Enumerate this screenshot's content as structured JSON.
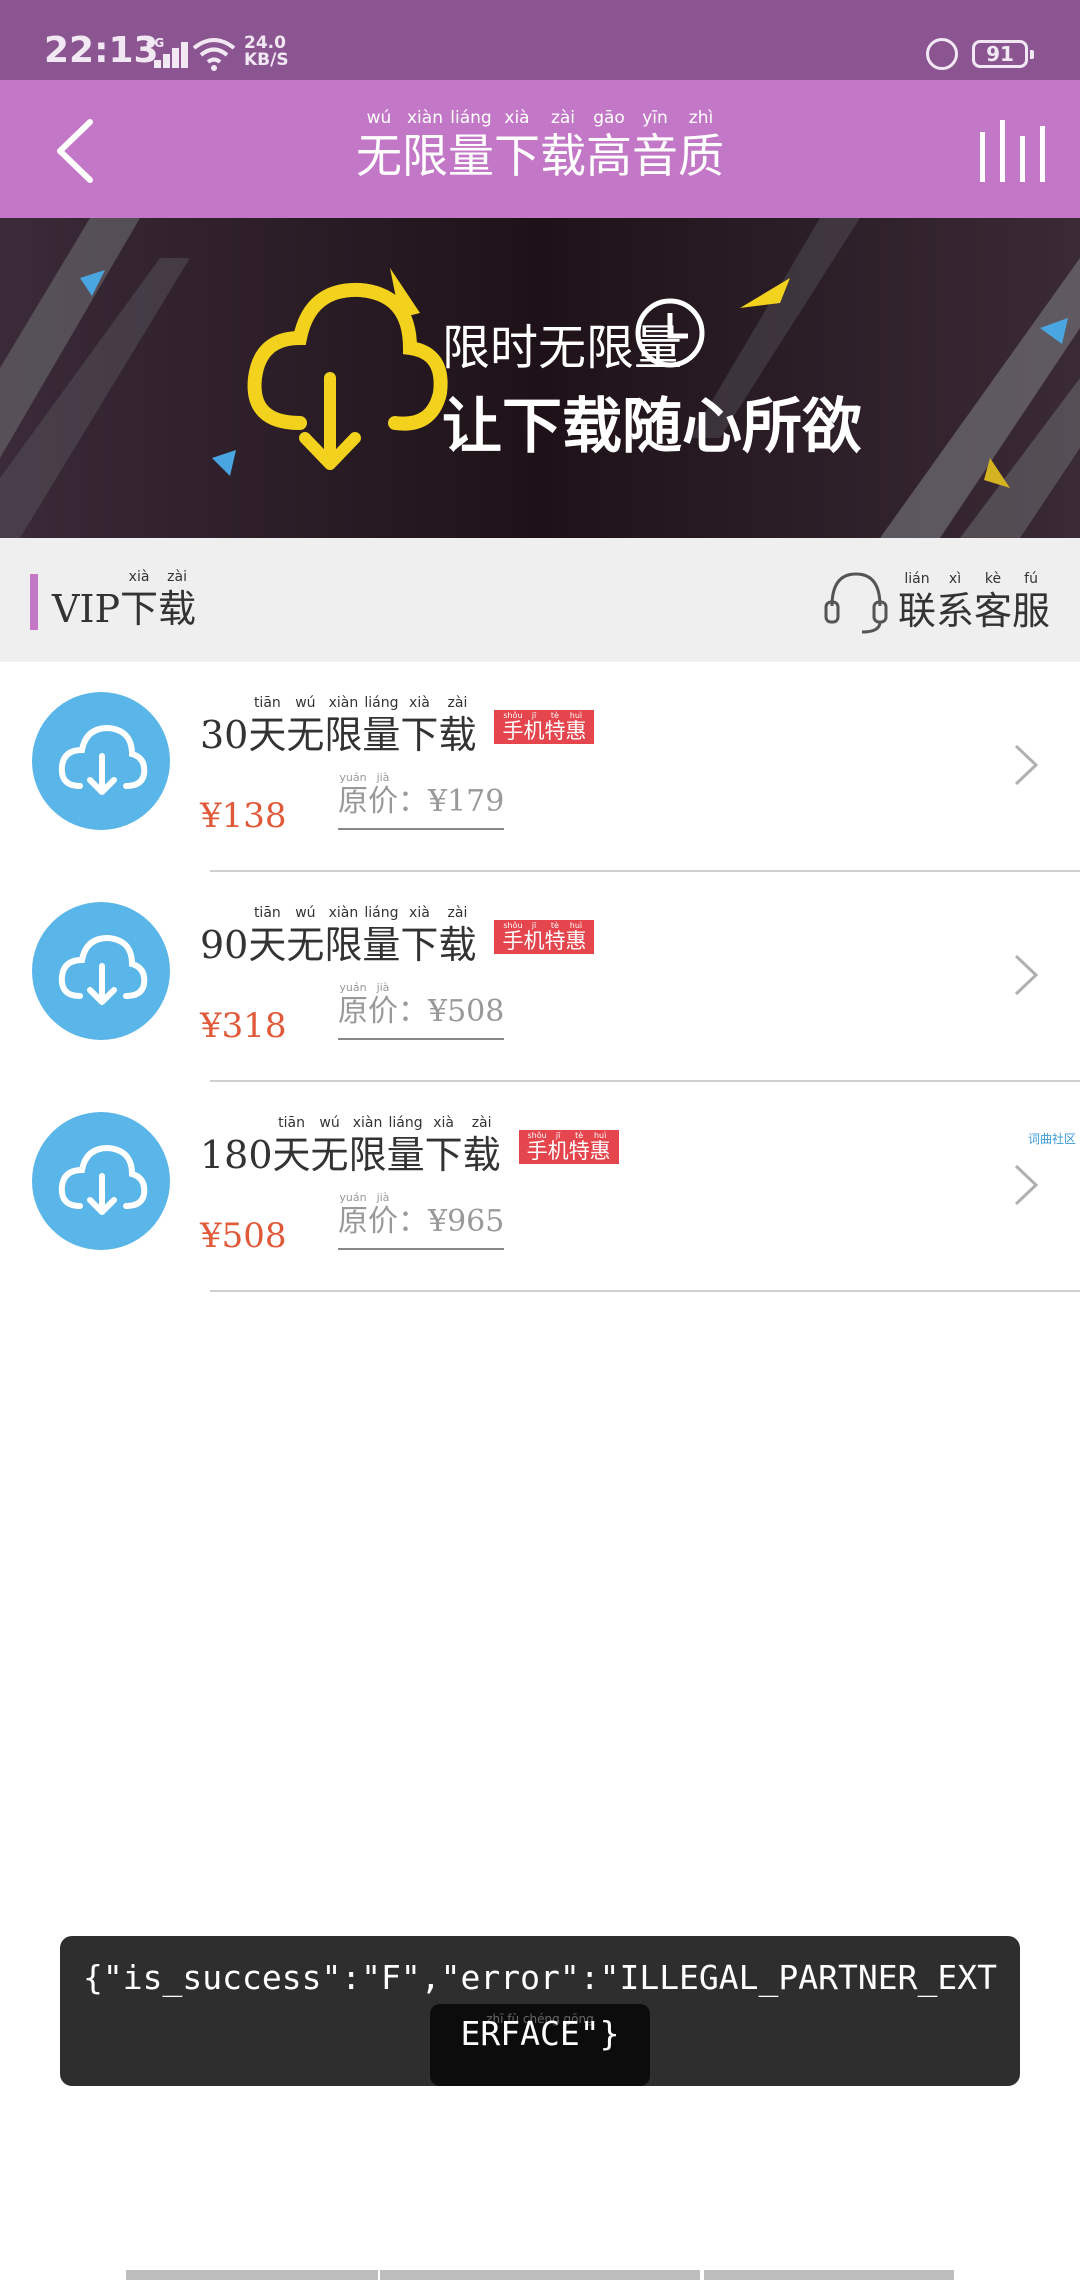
{
  "status_bar": {
    "time": "22:13",
    "network": "4G",
    "speed_value": "24.0",
    "speed_unit": "KB/S",
    "battery": "91"
  },
  "header": {
    "title": [
      {
        "py": "wú",
        "ch": "无"
      },
      {
        "py": "xiàn",
        "ch": "限"
      },
      {
        "py": "liáng",
        "ch": "量"
      },
      {
        "py": "xià",
        "ch": "下"
      },
      {
        "py": "zài",
        "ch": "载"
      },
      {
        "py": "gāo",
        "ch": "高"
      },
      {
        "py": "yīn",
        "ch": "音"
      },
      {
        "py": "zhì",
        "ch": "质"
      }
    ]
  },
  "banner": {
    "line1": "限时无限量",
    "line2": "让下载随心所欲"
  },
  "section": {
    "prefix": "VIP",
    "title": [
      {
        "py": "xià",
        "ch": "下"
      },
      {
        "py": "zài",
        "ch": "载"
      }
    ],
    "contact": [
      {
        "py": "lián",
        "ch": "联"
      },
      {
        "py": "xì",
        "ch": "系"
      },
      {
        "py": "kè",
        "ch": "客"
      },
      {
        "py": "fú",
        "ch": "服"
      }
    ]
  },
  "packages": [
    {
      "days": "30",
      "price": "¥138",
      "original": "¥179"
    },
    {
      "days": "90",
      "price": "¥318",
      "original": "¥508"
    },
    {
      "days": "180",
      "price": "¥508",
      "original": "¥965"
    }
  ],
  "package_name": [
    {
      "py": "tiān",
      "ch": "天"
    },
    {
      "py": "wú",
      "ch": "无"
    },
    {
      "py": "xiàn",
      "ch": "限"
    },
    {
      "py": "liáng",
      "ch": "量"
    },
    {
      "py": "xià",
      "ch": "下"
    },
    {
      "py": "zài",
      "ch": "载"
    }
  ],
  "badge": [
    {
      "py": "shǒu",
      "ch": "手"
    },
    {
      "py": "jī",
      "ch": "机"
    },
    {
      "py": "tè",
      "ch": "特"
    },
    {
      "py": "huì",
      "ch": "惠"
    }
  ],
  "original_label": [
    {
      "py": "yuán",
      "ch": "原"
    },
    {
      "py": "jià",
      "ch": "价"
    }
  ],
  "original_sep": "：",
  "side_tag": "词曲社区",
  "toast": {
    "message": "{\"is_success\":\"F\",\"error\":\"ILLEGAL_PARTNER_EXTERFACE\"}",
    "underlay_pinyin": "zhī fù chéng gōng"
  },
  "colors": {
    "header": "#c378c7",
    "accent_price": "#e05a3a",
    "icon_blue": "#5ab6e8",
    "badge": "#e5454c"
  }
}
